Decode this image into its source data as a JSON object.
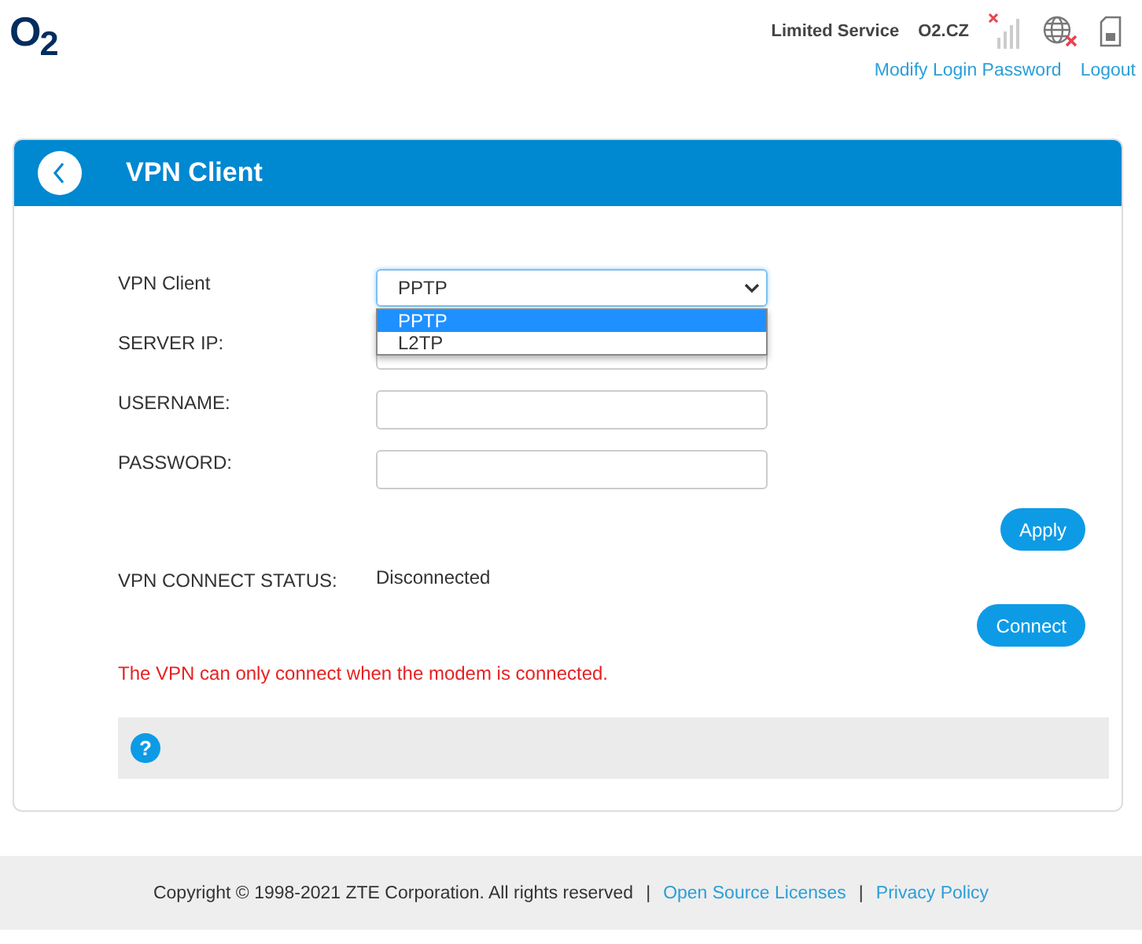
{
  "header": {
    "logo": "O$_{2}$",
    "status": "Limited Service",
    "carrier": "O2.CZ",
    "links": [
      "Modify Login Password",
      "Logout"
    ]
  },
  "panel": {
    "title": "VPN Client",
    "vpn_client": {
      "label": "VPN Client",
      "value": "PPTP",
      "expanded": true,
      "options": [
        {
          "label": "PPTP",
          "selected": true
        },
        {
          "label": "L2TP",
          "selected": false
        }
      ]
    },
    "fields": [
      {
        "label": "SERVER IP:"
      },
      {
        "label": "USERNAME:"
      },
      {
        "label": "PASSWORD:"
      }
    ],
    "apply_button": "Apply",
    "connect_status": {
      "label": "VPN CONNECT STATUS:",
      "value": "Disconnected"
    },
    "connect_button": "Connect",
    "warning": "The VPN can only connect when the modem is connected.",
    "help_icon": "?"
  },
  "footer": {
    "copyright": "Copyright © 1998-2021 ZTE Corporation. All rights reserved",
    "separator": "|",
    "links": [
      "Open Source Licenses",
      "Privacy Policy"
    ]
  }
}
